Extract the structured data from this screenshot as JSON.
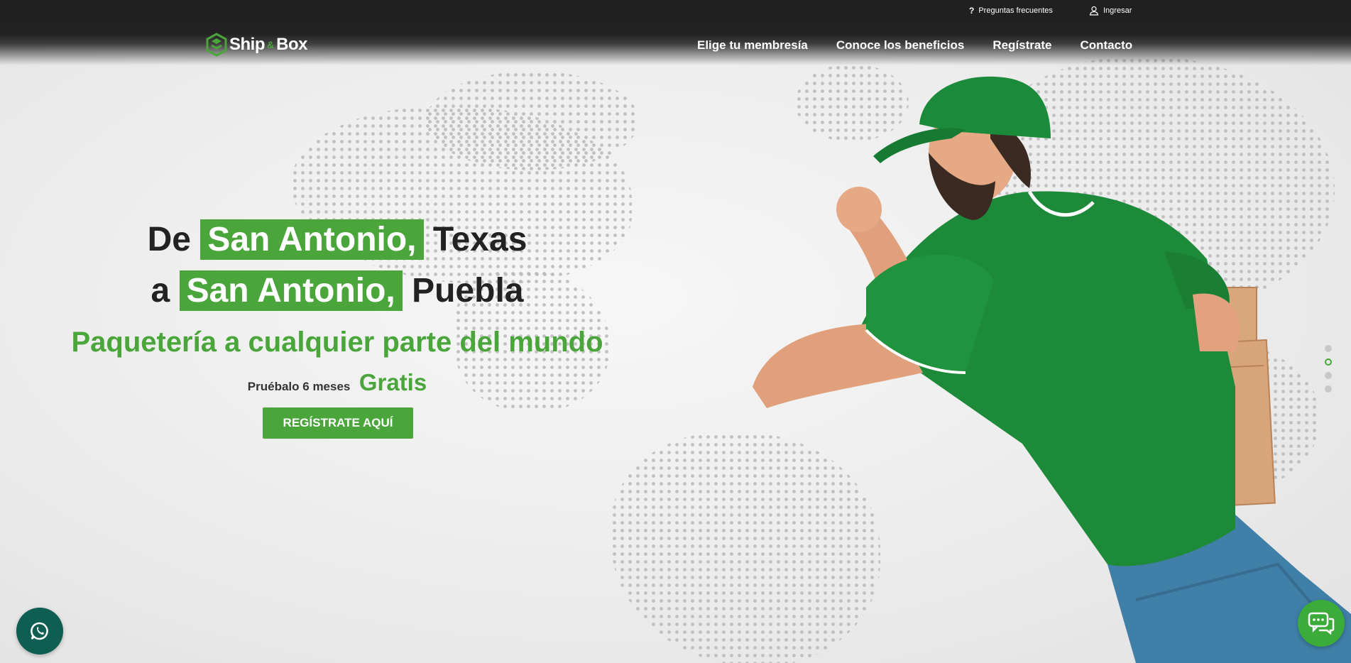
{
  "topbar": {
    "faq_icon": "?",
    "faq_label": "Preguntas frecuentes",
    "login_label": "Ingresar"
  },
  "logo": {
    "part1": "Ship",
    "amp": "&",
    "part2": "Box"
  },
  "nav": {
    "items": [
      {
        "label": "Elige tu membresía"
      },
      {
        "label": "Conoce los beneficios"
      },
      {
        "label": "Regístrate"
      },
      {
        "label": "Contacto"
      }
    ]
  },
  "hero": {
    "line1_pre": "De",
    "line1_highlight": "San Antonio,",
    "line1_post": "Texas",
    "line2_pre": "a",
    "line2_highlight": "San Antonio,",
    "line2_post": "Puebla",
    "tagline": "Paquetería a cualquier parte del mundo",
    "trial_pre": "Pruébalo 6 meses",
    "trial_free": "Gratis",
    "cta_label": "REGÍSTRATE AQUÍ"
  },
  "slider": {
    "active_index": 1,
    "count": 4
  },
  "colors": {
    "brand_green": "#4aa63a",
    "dark_bar": "#222222",
    "whatsapp": "#0e5e52",
    "chat": "#3bab3a"
  },
  "icons": [
    "question-icon",
    "user-icon",
    "shipbox-logo-icon",
    "whatsapp-icon",
    "chat-icon"
  ]
}
